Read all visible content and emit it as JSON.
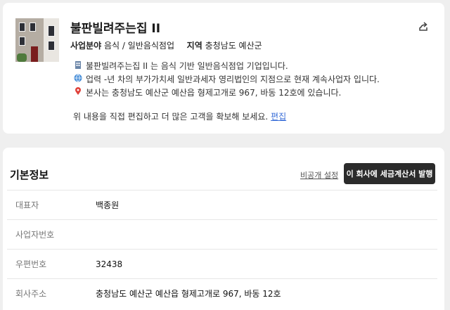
{
  "profile": {
    "company_name": "불판빌려주는집 II",
    "industry_label": "사업분야",
    "industry_value": "음식 / 일반음식점업",
    "region_label": "지역",
    "region_value": "충청남도 예산군",
    "desc1": "불판빌려주는집 II 는 음식 기반 일반음식점업 기업입니다.",
    "desc2": "업력 -년 차의 부가가치세 일반과세자 영리법인의 지점으로 현재 계속사업자 입니다.",
    "desc3": "본사는 충청남도 예산군 예산읍 형제고개로 967, 바동 12호에 있습니다.",
    "edit_prompt": "위 내용을 직접 편집하고 더 많은 고객을 확보해 보세요.",
    "edit_link": "편집",
    "icons": [
      "building-icon",
      "globe-icon",
      "map-pin-icon",
      "share-icon"
    ]
  },
  "basic_info": {
    "title": "기본정보",
    "private_setting": "비공개 설정",
    "invoice_button": "이 회사에 세금계산서 발행",
    "rows": [
      {
        "label": "대표자",
        "value": "백종원"
      },
      {
        "label": "사업자번호",
        "value": ""
      },
      {
        "label": "우편번호",
        "value": "32438"
      },
      {
        "label": "회사주소",
        "value": "충청남도 예산군 예산읍 형제고개로 967, 바동 12호"
      }
    ]
  }
}
